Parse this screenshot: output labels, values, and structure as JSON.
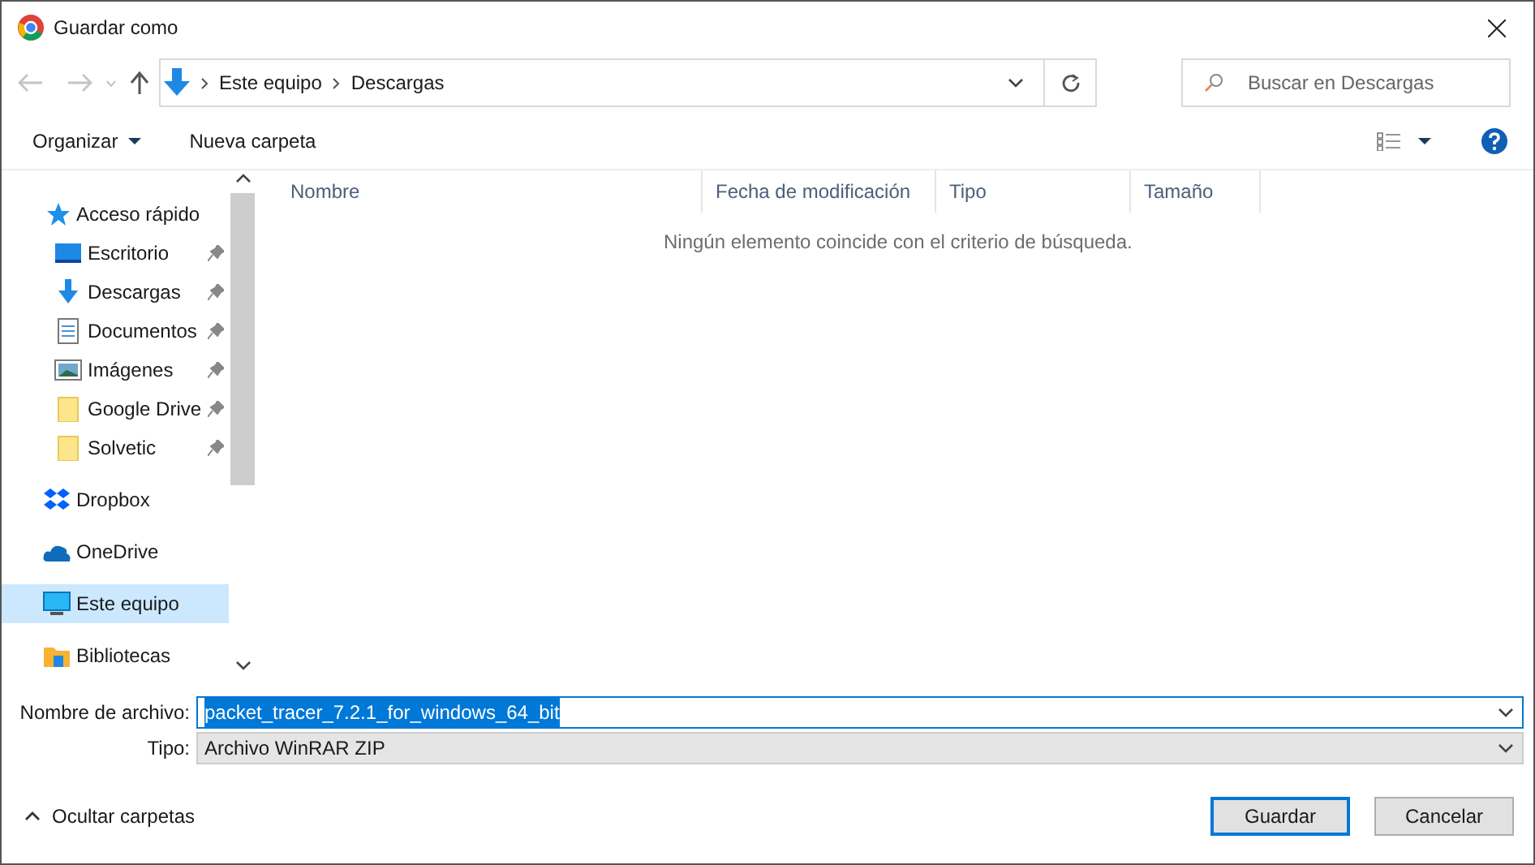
{
  "window": {
    "title": "Guardar como"
  },
  "address": {
    "crumbs": [
      "Este equipo",
      "Descargas"
    ]
  },
  "search": {
    "placeholder": "Buscar en Descargas"
  },
  "toolbar": {
    "organize": "Organizar",
    "new_folder": "Nueva carpeta"
  },
  "sidebar": {
    "items": [
      {
        "label": "Acceso rápido",
        "selected": false,
        "children": [
          {
            "label": "Escritorio",
            "selected": false,
            "pinned": true
          },
          {
            "label": "Descargas",
            "selected": false,
            "pinned": true
          },
          {
            "label": "Documentos",
            "selected": false,
            "pinned": true
          },
          {
            "label": "Imágenes",
            "selected": false,
            "pinned": true
          },
          {
            "label": "Google Drive",
            "selected": false,
            "pinned": true
          },
          {
            "label": "Solvetic",
            "selected": false,
            "pinned": true
          }
        ]
      },
      {
        "label": "Dropbox",
        "selected": false
      },
      {
        "label": "OneDrive",
        "selected": false
      },
      {
        "label": "Este equipo",
        "selected": true
      },
      {
        "label": "Bibliotecas",
        "selected": false
      }
    ]
  },
  "table": {
    "columns": [
      "Nombre",
      "Fecha de modificación",
      "Tipo",
      "Tamaño"
    ],
    "empty_message": "Ningún elemento coincide con el criterio de búsqueda."
  },
  "file_name": {
    "label": "Nombre de archivo:",
    "value": "packet_tracer_7.2.1_for_windows_64_bit",
    "text_selected": true
  },
  "file_type": {
    "label": "Tipo:",
    "value": "Archivo WinRAR ZIP"
  },
  "hide_folders": "Ocultar carpetas",
  "buttons": [
    "Guardar",
    "Cancelar"
  ]
}
